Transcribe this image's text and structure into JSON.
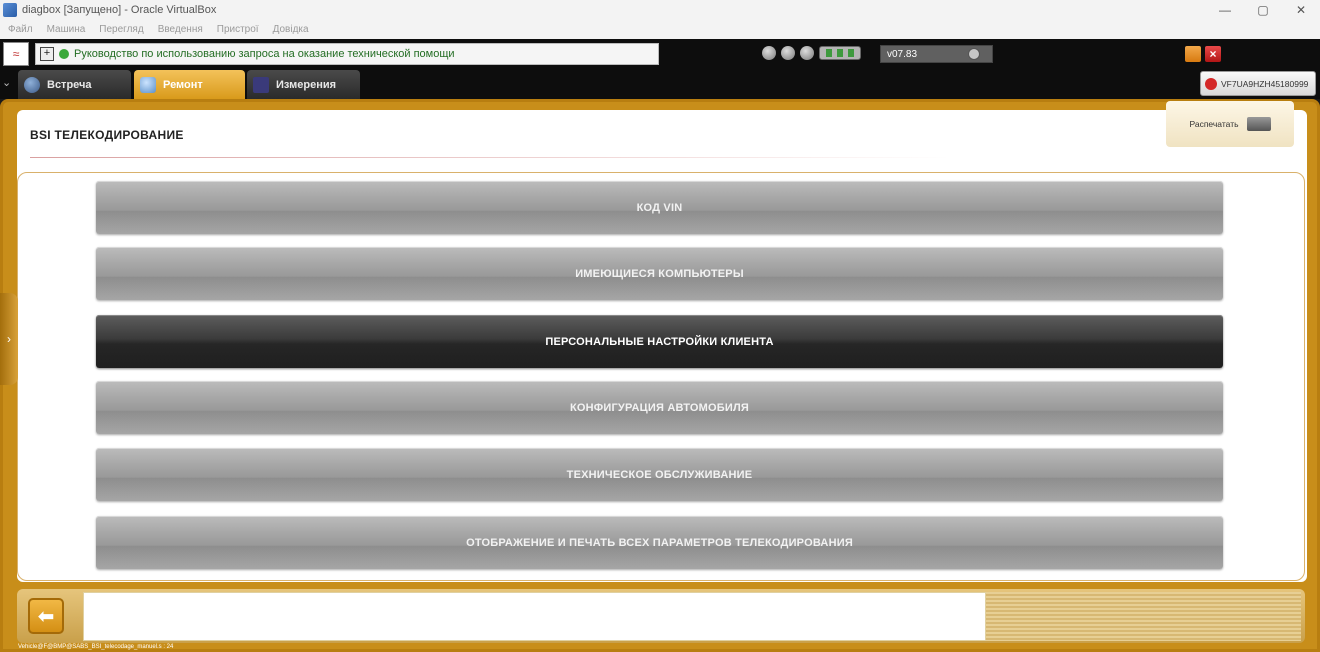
{
  "window": {
    "title": "diagbox [Запущено] - Oracle VirtualBox",
    "minimize": "—",
    "restore": "▢",
    "close": "✕"
  },
  "menubar": [
    "Файл",
    "Машина",
    "Перегляд",
    "Введення",
    "Пристрої",
    "Довідка"
  ],
  "topbar": {
    "help_text": "Руководство по использованию запроса на оказание технической помощи",
    "version": "v07.83"
  },
  "tabs": [
    {
      "label": "Встреча",
      "active": false
    },
    {
      "label": "Ремонт",
      "active": true
    },
    {
      "label": "Измерения",
      "active": false
    }
  ],
  "vin": "VF7UA9HZH45180999",
  "header": {
    "title": "BSI  ТЕЛЕКОДИРОВАНИЕ",
    "print_label": "Распечатать"
  },
  "menu": [
    {
      "label": "КОД VIN",
      "active": false
    },
    {
      "label": "ИМЕЮЩИЕСЯ КОМПЬЮТЕРЫ",
      "active": false
    },
    {
      "label": "ПЕРСОНАЛЬНЫЕ НАСТРОЙКИ КЛИЕНТА",
      "active": true
    },
    {
      "label": "КОНФИГУРАЦИЯ АВТОМОБИЛЯ",
      "active": false
    },
    {
      "label": "ТЕХНИЧЕСКОЕ ОБСЛУЖИВАНИЕ",
      "active": false
    },
    {
      "label": "ОТОБРАЖЕНИЕ И ПЕЧАТЬ ВСЕХ ПАРАМЕТРОВ ТЕЛЕКОДИРОВАНИЯ",
      "active": false
    }
  ],
  "footer": {
    "status": "Vehicle@F@BMP@SABS_BSI_telecodage_manuel.s : 24"
  },
  "colors": {
    "frame": "#c88e1a",
    "active_tab": "#e0a42a",
    "menu_active": "#2b2b2b",
    "menu_inactive": "#a3a3a3"
  }
}
